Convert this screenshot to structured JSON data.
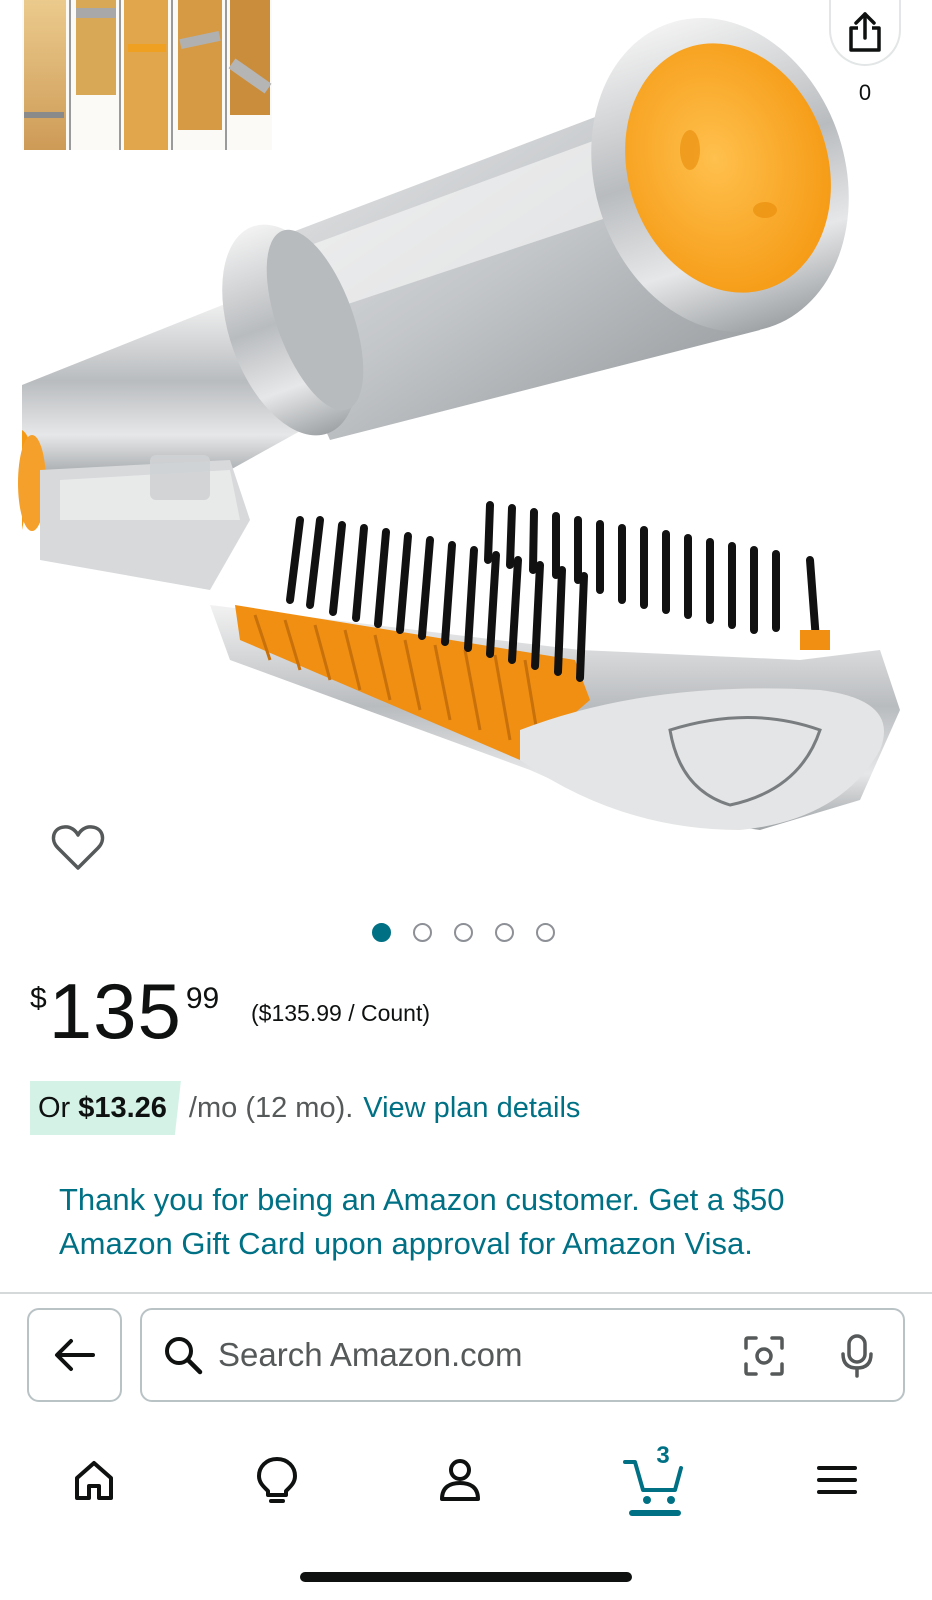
{
  "product": {
    "share_count": "0",
    "carousel": {
      "total": 5,
      "active": 1
    }
  },
  "price": {
    "symbol": "$",
    "whole": "135",
    "fraction": "99",
    "unit_price": "($135.99 / Count)"
  },
  "financing": {
    "prefix": "Or",
    "monthly_amount": "$13.26",
    "term": "/mo (12 mo).",
    "link": "View plan details"
  },
  "promo": {
    "text": "Thank you for being an Amazon customer. Get a $50 Amazon Gift Card upon approval for Amazon Visa."
  },
  "search": {
    "placeholder": "Search Amazon.com"
  },
  "bottom_nav": {
    "cart_count": "3",
    "items": [
      "home-icon",
      "lightbulb-icon",
      "account-icon",
      "cart-icon",
      "menu-icon"
    ],
    "active": "cart"
  },
  "colors": {
    "link": "#007185",
    "accent_orange": "#f5a623",
    "financing_bg": "#d5f2e7"
  }
}
